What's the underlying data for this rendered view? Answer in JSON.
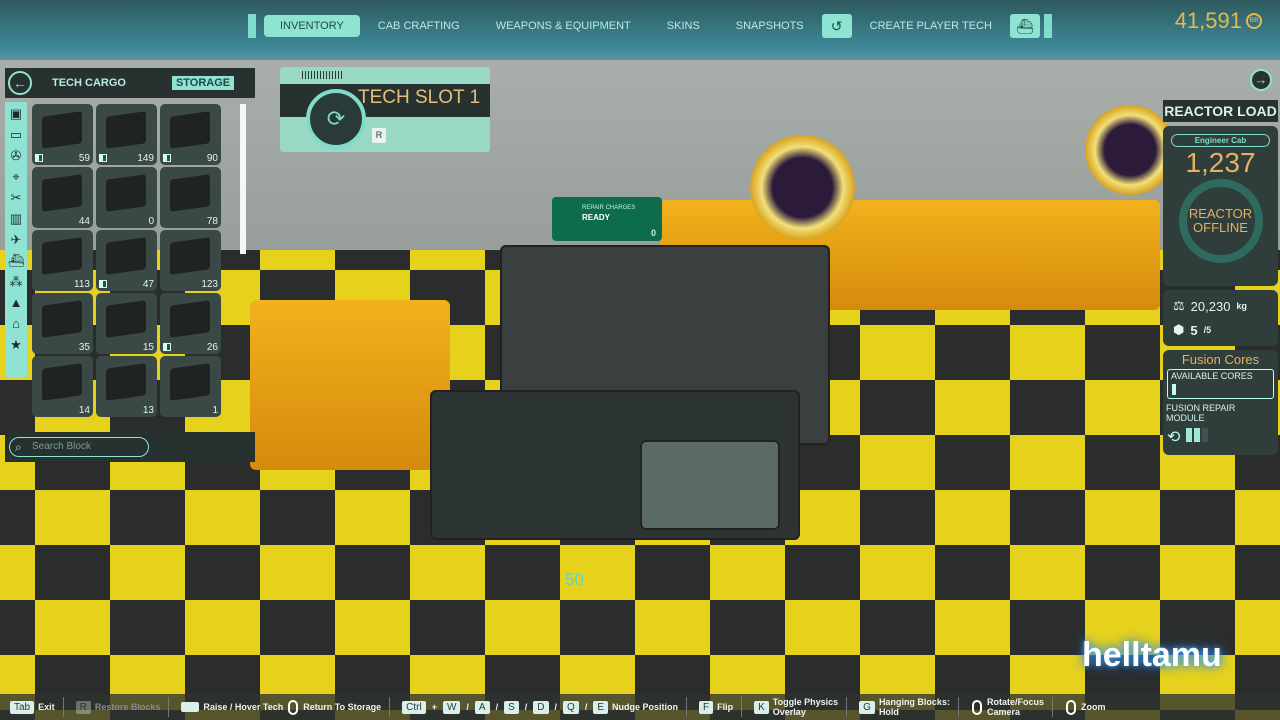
{
  "nav": {
    "tabs": [
      "INVENTORY",
      "CAB CRAFTING",
      "WEAPONS & EQUIPMENT",
      "SKINS",
      "SNAPSHOTS",
      "CREATE PLAYER TECH"
    ],
    "active": "INVENTORY",
    "currency": "41,591",
    "currency_icon": "BB"
  },
  "left_panel": {
    "tabs": [
      "TECH CARGO",
      "STORAGE"
    ],
    "active_tab": "STORAGE",
    "categories": [
      "all-blocks",
      "cab",
      "wheels",
      "targeting",
      "tools",
      "structure",
      "air",
      "water",
      "resources",
      "accessories",
      "factory",
      "favorites"
    ],
    "blocks": [
      {
        "count": "59",
        "pair": true
      },
      {
        "count": "149",
        "pair": true
      },
      {
        "count": "90",
        "pair": true
      },
      {
        "count": "44"
      },
      {
        "count": "0"
      },
      {
        "count": "78"
      },
      {
        "count": "113"
      },
      {
        "count": "47",
        "pair": true
      },
      {
        "count": "123"
      },
      {
        "count": "35"
      },
      {
        "count": "15"
      },
      {
        "count": "26",
        "pair": true
      },
      {
        "count": "14"
      },
      {
        "count": "13"
      },
      {
        "count": "1"
      }
    ],
    "search_placeholder": "Search Block"
  },
  "tech_slot": {
    "title": "TECH SLOT 1",
    "key": "R"
  },
  "scene": {
    "sign_line1": "REPAIR",
    "sign_line2": "CHARGES",
    "sign_status": "READY",
    "sign_count": "0",
    "distance": "50",
    "watermark": "helltamu"
  },
  "reactor": {
    "title": "REACTOR LOAD",
    "cab": "Engineer Cab",
    "load": "1,237",
    "status_line1": "REACTOR",
    "status_line2": "OFFLINE",
    "mass": "20,230",
    "mass_unit": "kg",
    "repair": "5",
    "repair_max": "/5",
    "fusion_title": "Fusion Cores",
    "available": "AVAILABLE CORES",
    "module_line1": "FUSION REPAIR",
    "module_line2": "MODULE",
    "module_charges": 2,
    "module_capacity": 3
  },
  "controls": [
    {
      "key": "Tab",
      "label": "Exit"
    },
    {
      "key": "R",
      "label": "Restore Blocks",
      "disabled": true
    },
    {
      "key": "space",
      "label": "Raise / Hover Tech"
    },
    {
      "key": "mouse",
      "label": "Return To Storage"
    },
    {
      "keys": [
        "Ctrl",
        "+",
        "W",
        "/",
        "A",
        "/",
        "S",
        "/",
        "D",
        "/",
        "Q",
        "/",
        "E"
      ],
      "label": "Nudge Position"
    },
    {
      "key": "F",
      "label": "Flip"
    },
    {
      "key": "K",
      "label1": "Toggle Physics",
      "label2": "Overlay"
    },
    {
      "key": "G",
      "label1": "Hanging Blocks:",
      "label2": "Hold"
    },
    {
      "key": "mouse",
      "label1": "Rotate/Focus",
      "label2": "Camera"
    },
    {
      "key": "mouse",
      "label": "Zoom"
    }
  ]
}
